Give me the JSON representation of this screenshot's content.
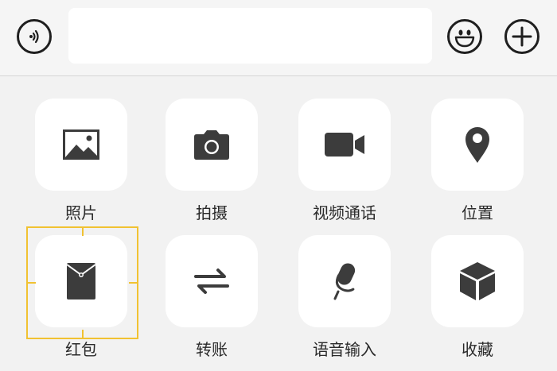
{
  "input_bar": {
    "voice_icon": "voice-icon",
    "message_input": {
      "value": "",
      "placeholder": ""
    },
    "emoji_icon": "emoji-icon",
    "more_icon": "plus-icon"
  },
  "actions": [
    {
      "label": "照片",
      "icon": "image-icon"
    },
    {
      "label": "拍摄",
      "icon": "camera-icon"
    },
    {
      "label": "视频通话",
      "icon": "video-camera-icon"
    },
    {
      "label": "位置",
      "icon": "location-pin-icon"
    },
    {
      "label": "红包",
      "icon": "red-packet-icon"
    },
    {
      "label": "转账",
      "icon": "transfer-arrows-icon"
    },
    {
      "label": "语音输入",
      "icon": "microphone-icon"
    },
    {
      "label": "收藏",
      "icon": "cube-icon"
    }
  ],
  "colors": {
    "focus": "#f1c232",
    "icon": "#3c3c3c",
    "tile": "#ffffff"
  }
}
